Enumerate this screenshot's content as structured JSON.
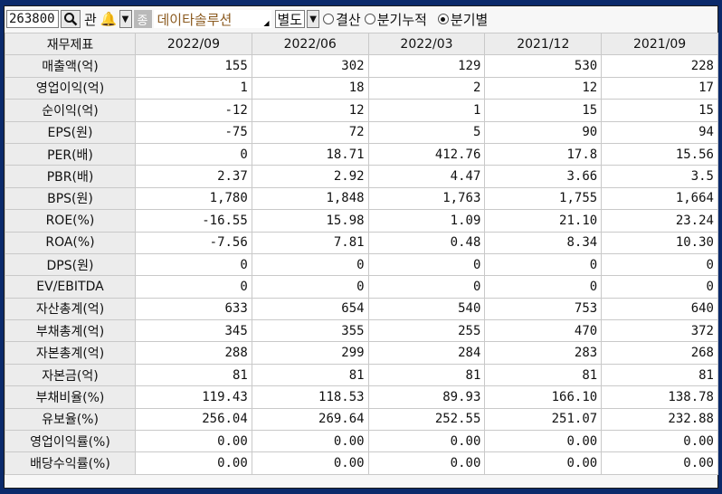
{
  "toolbar": {
    "code": "263800",
    "search_icon": "search-icon",
    "kwan_label": "관",
    "bell_icon": "bell-icon",
    "jung_badge": "종",
    "company_name": "데이타솔루션",
    "bieldo_label": "별도",
    "radios": [
      {
        "label": "결산",
        "selected": false
      },
      {
        "label": "분기누적",
        "selected": false
      },
      {
        "label": "분기별",
        "selected": true
      }
    ]
  },
  "table": {
    "header": [
      "재무제표",
      "2022/09",
      "2022/06",
      "2022/03",
      "2021/12",
      "2021/09"
    ],
    "rows": [
      {
        "label": "매출액(억)",
        "values": [
          "155",
          "302",
          "129",
          "530",
          "228"
        ]
      },
      {
        "label": "영업이익(억)",
        "values": [
          "1",
          "18",
          "2",
          "12",
          "17"
        ]
      },
      {
        "label": "순이익(억)",
        "values": [
          "-12",
          "12",
          "1",
          "15",
          "15"
        ]
      },
      {
        "label": "EPS(원)",
        "values": [
          "-75",
          "72",
          "5",
          "90",
          "94"
        ]
      },
      {
        "label": "PER(배)",
        "values": [
          "0",
          "18.71",
          "412.76",
          "17.8",
          "15.56"
        ]
      },
      {
        "label": "PBR(배)",
        "values": [
          "2.37",
          "2.92",
          "4.47",
          "3.66",
          "3.5"
        ]
      },
      {
        "label": "BPS(원)",
        "values": [
          "1,780",
          "1,848",
          "1,763",
          "1,755",
          "1,664"
        ]
      },
      {
        "label": "ROE(%)",
        "values": [
          "-16.55",
          "15.98",
          "1.09",
          "21.10",
          "23.24"
        ]
      },
      {
        "label": "ROA(%)",
        "values": [
          "-7.56",
          "7.81",
          "0.48",
          "8.34",
          "10.30"
        ]
      },
      {
        "label": "DPS(원)",
        "values": [
          "0",
          "0",
          "0",
          "0",
          "0"
        ]
      },
      {
        "label": "EV/EBITDA",
        "values": [
          "0",
          "0",
          "0",
          "0",
          "0"
        ]
      },
      {
        "label": "자산총계(억)",
        "values": [
          "633",
          "654",
          "540",
          "753",
          "640"
        ]
      },
      {
        "label": "부채총계(억)",
        "values": [
          "345",
          "355",
          "255",
          "470",
          "372"
        ]
      },
      {
        "label": "자본총계(억)",
        "values": [
          "288",
          "299",
          "284",
          "283",
          "268"
        ]
      },
      {
        "label": "자본금(억)",
        "values": [
          "81",
          "81",
          "81",
          "81",
          "81"
        ]
      },
      {
        "label": "부채비율(%)",
        "values": [
          "119.43",
          "118.53",
          "89.93",
          "166.10",
          "138.78"
        ]
      },
      {
        "label": "유보율(%)",
        "values": [
          "256.04",
          "269.64",
          "252.55",
          "251.07",
          "232.88"
        ]
      },
      {
        "label": "영업이익률(%)",
        "values": [
          "0.00",
          "0.00",
          "0.00",
          "0.00",
          "0.00"
        ]
      },
      {
        "label": "배당수익률(%)",
        "values": [
          "0.00",
          "0.00",
          "0.00",
          "0.00",
          "0.00"
        ]
      }
    ]
  }
}
